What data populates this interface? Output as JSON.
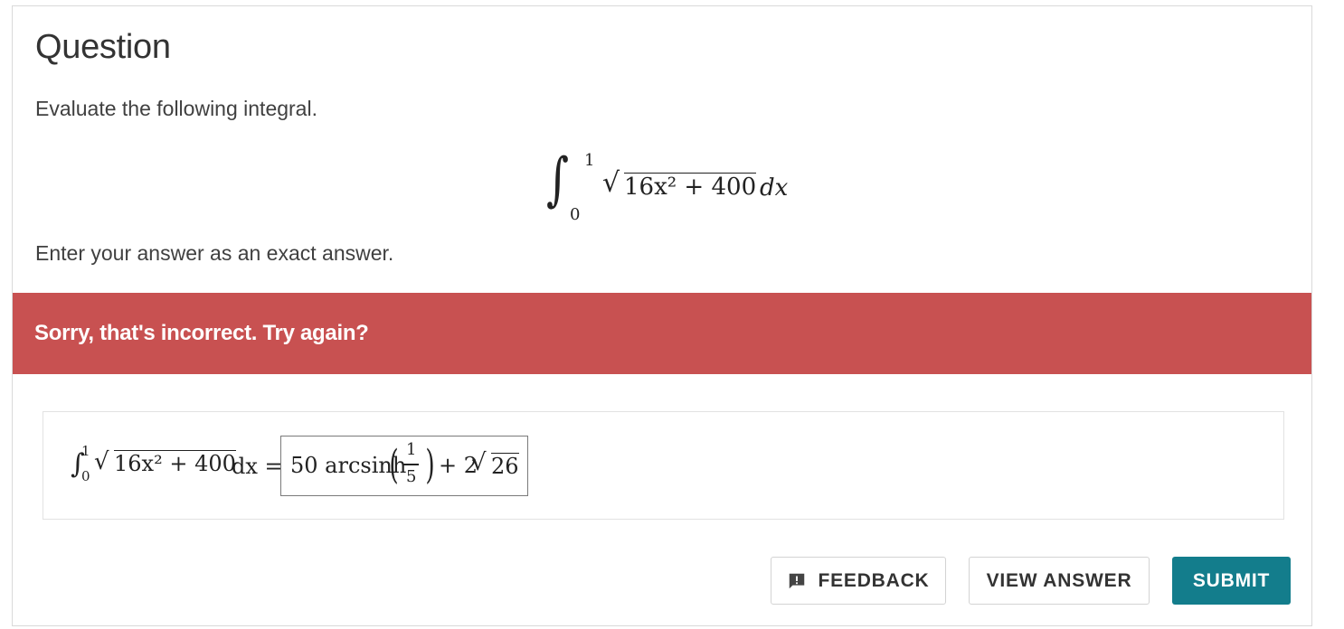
{
  "question": {
    "heading": "Question",
    "prompt": "Evaluate the following integral.",
    "integral": {
      "upper_bound": "1",
      "lower_bound": "0",
      "integrand": "16x² + 400",
      "differential": "dx"
    },
    "instruction": "Enter your answer as an exact answer."
  },
  "feedback_banner": {
    "message": "Sorry, that's incorrect. Try again?",
    "color": "#c85151"
  },
  "answer": {
    "lhs_upper": "1",
    "lhs_lower": "0",
    "lhs_integrand": "16x² + 400",
    "lhs_suffix": "dx =",
    "input_value": {
      "coefficient": "50 arcsinh",
      "fraction_numerator": "1",
      "fraction_denominator": "5",
      "plus_term": "+ 2",
      "radicand": "26"
    }
  },
  "buttons": {
    "feedback": "FEEDBACK",
    "view_answer": "VIEW ANSWER",
    "submit": "SUBMIT",
    "submit_color": "#137d8c"
  }
}
